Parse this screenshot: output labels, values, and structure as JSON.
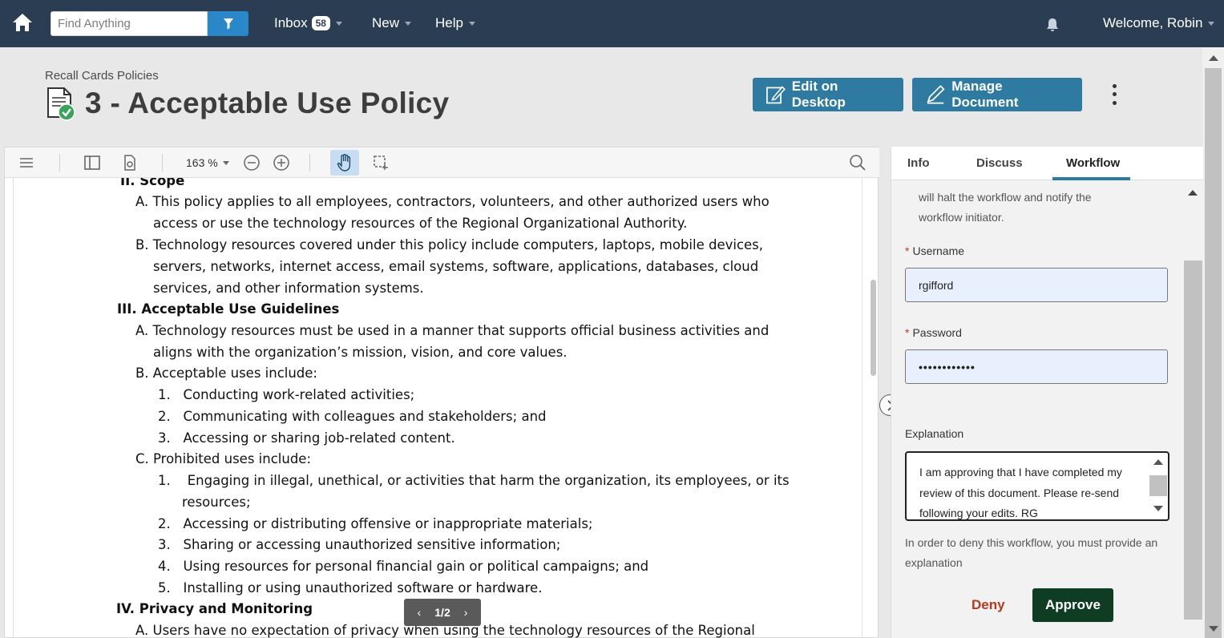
{
  "nav": {
    "search_placeholder": "Find Anything",
    "inbox_label": "Inbox",
    "inbox_count": "58",
    "new_label": "New",
    "help_label": "Help",
    "welcome": "Welcome, Robin"
  },
  "header": {
    "breadcrumb": "Recall Cards Policies",
    "title": "3 - Acceptable Use Policy",
    "edit_desktop": "Edit on Desktop",
    "manage_document": "Manage Document"
  },
  "viewer": {
    "zoom": "163 %",
    "pager": "1/2",
    "lines": [
      {
        "t": "II. Scope",
        "h": true
      },
      {
        "t": "A. This policy applies to all employees, contractors, volunteers, and other authorized users who",
        "h": false
      },
      {
        "t": "access or use the technology resources of the Regional Organizational Authority.",
        "h": false
      },
      {
        "t": "B. Technology resources covered under this policy include computers, laptops, mobile devices,",
        "h": false
      },
      {
        "t": "servers, networks, internet access, email systems, software, applications, databases, cloud",
        "h": false
      },
      {
        "t": "services, and other information systems.",
        "h": false
      },
      {
        "t": "III. Acceptable Use Guidelines",
        "h": true
      },
      {
        "t": "A. Technology resources must be used in a manner that supports official business activities and",
        "h": false
      },
      {
        "t": "aligns with the organization’s mission, vision, and core values.",
        "h": false
      },
      {
        "t": "B. Acceptable uses include:",
        "h": false
      },
      {
        "t": "1.   Conducting work-related activities;",
        "h": false
      },
      {
        "t": "2.   Communicating with colleagues and stakeholders; and",
        "h": false
      },
      {
        "t": "3.   Accessing or sharing job-related content.",
        "h": false
      },
      {
        "t": "C. Prohibited uses include:",
        "h": false
      },
      {
        "t": "1.    Engaging in illegal, unethical, or activities that harm the organization, its employees, or its",
        "h": false
      },
      {
        "t": "resources;",
        "h": false
      },
      {
        "t": "2.   Accessing or distributing offensive or inappropriate materials;",
        "h": false
      },
      {
        "t": "3.   Sharing or accessing unauthorized sensitive information;",
        "h": false
      },
      {
        "t": "4.   Using resources for personal financial gain or political campaigns; and",
        "h": false
      },
      {
        "t": "5.   Installing or using unauthorized software or hardware.",
        "h": false
      },
      {
        "t": "IV. Privacy and Monitoring",
        "h": true
      },
      {
        "t": "A. Users have no expectation of privacy when using the technology resources of the Regional",
        "h": false
      }
    ]
  },
  "panel": {
    "tabs": [
      "Info",
      "Discuss",
      "Workflow"
    ],
    "intro_text_1": "will halt the workflow and notify the",
    "intro_text_2": "workflow initiator.",
    "username_label": "Username",
    "username_value": "rgifford",
    "password_label": "Password",
    "password_value": "••••••••••••",
    "explanation_label": "Explanation",
    "explanation_value": "I am approving that I have completed my review of this document. Please re-send following your edits. RG",
    "deny_hint": "In order to deny this workflow, you must provide an explanation",
    "deny_label": "Deny",
    "approve_label": "Approve"
  },
  "colors": {
    "nav_bg": "#2b3d52",
    "accent": "#2e7aa0",
    "approve_bg": "#0e3d23",
    "deny_text": "#b23a1e"
  }
}
